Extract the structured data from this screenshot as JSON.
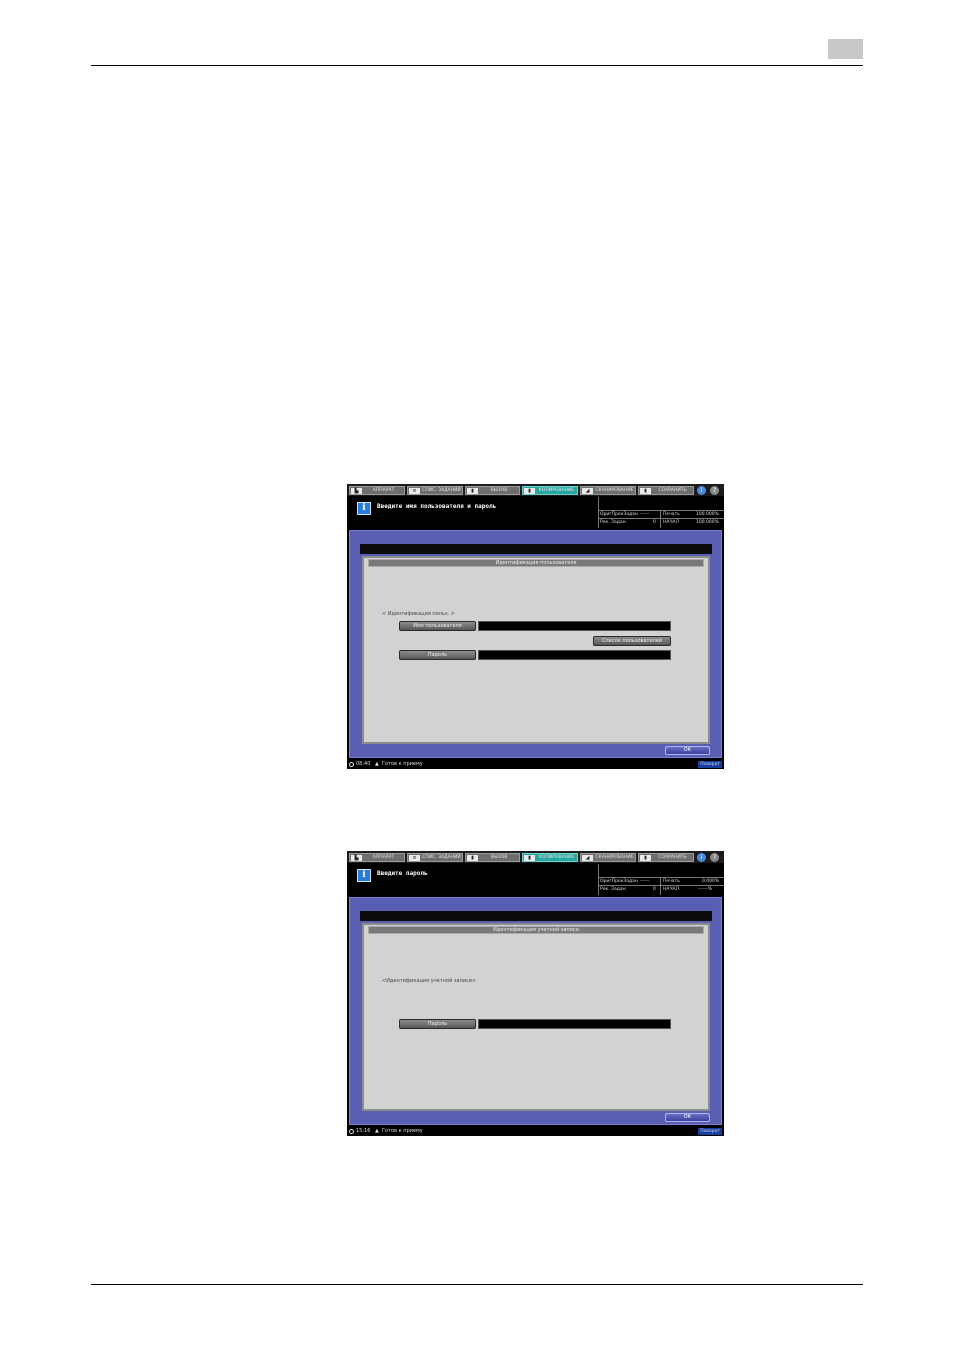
{
  "screens": [
    {
      "tabs": [
        "АППАРАТ",
        "СПИС. ЗАДАНИЙ",
        "ВЫЗОВ",
        "КОПИРОВАНИЕ",
        "СКАНИРОВАНИЕ",
        "СОХРАНИТЬ"
      ],
      "active_tab": 3,
      "message": "Введите имя пользователя и пароль",
      "counters": {
        "r1_label": "ОригПрокЗадан",
        "r1_value": "------",
        "r1b_label": "Печать",
        "r1b_value": "100.000%",
        "r2_label": "Рек. Задан.",
        "r2_value": "0",
        "r2b_label": "НАЧАЛ",
        "r2b_value": "100.000%"
      },
      "dialog_title": "Идентификация пользователя",
      "section_label": "< Идентификация польз. >",
      "username_button": "Имя пользователя",
      "userlist_button": "Список пользователей",
      "password_button": "Пароль",
      "ok": "ОК",
      "status_time": "08:40",
      "status_text": "Готов к приему",
      "status_badge": "Поворот"
    },
    {
      "tabs": [
        "АППАРАТ",
        "СПИС. ЗАДАНИЙ",
        "ВЫЗОВ",
        "КОПИРОВАНИЕ",
        "СКАНИРОВАНИЕ",
        "СОХРАНИТЬ"
      ],
      "active_tab": 3,
      "message": "Введите пароль",
      "counters": {
        "r1_label": "ОригПрокЗадан",
        "r1_value": "------",
        "r1b_label": "Печать",
        "r1b_value": "0.000%",
        "r2_label": "Рек. Задан.",
        "r2_value": "0",
        "r2b_label": "НАЧАЛ",
        "r2b_value": "------%"
      },
      "dialog_title": "Идентификация учетной записи",
      "section_label": "<Идентификация учетной записи>",
      "password_button": "Пароль",
      "ok": "ОК",
      "status_time": "15:16",
      "status_text": "Готов к приему",
      "status_badge": "Поворот"
    }
  ]
}
